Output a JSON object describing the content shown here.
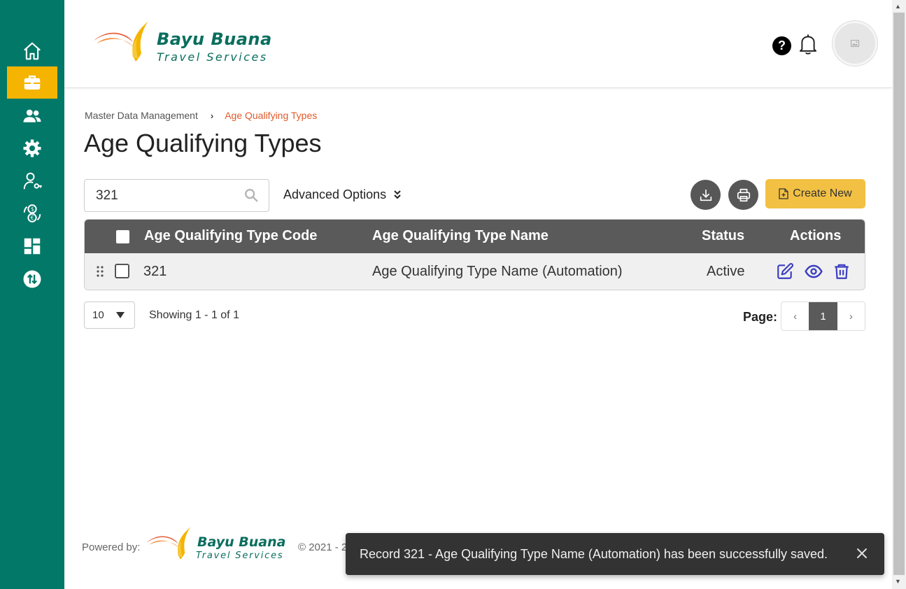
{
  "brand": {
    "name": "Bayu Buana",
    "tagline": "Travel Services",
    "primary_color": "#017868",
    "accent_color": "#f4b400"
  },
  "sidebar": {
    "items": [
      {
        "name": "home",
        "icon": "home-icon",
        "active": false
      },
      {
        "name": "briefcase",
        "icon": "briefcase-icon",
        "active": true
      },
      {
        "name": "users",
        "icon": "users-icon",
        "active": false
      },
      {
        "name": "settings",
        "icon": "gear-icon",
        "active": false
      },
      {
        "name": "user-key",
        "icon": "user-key-icon",
        "active": false
      },
      {
        "name": "currency-exchange",
        "icon": "currency-exchange-icon",
        "active": false
      },
      {
        "name": "dashboard",
        "icon": "dashboard-icon",
        "active": false
      },
      {
        "name": "transfer",
        "icon": "transfer-icon",
        "active": false
      }
    ]
  },
  "header": {
    "help_label": "?"
  },
  "breadcrumb": {
    "parent": "Master Data Management",
    "separator": "›",
    "current": "Age Qualifying Types"
  },
  "page": {
    "title": "Age Qualifying Types"
  },
  "toolbar": {
    "search_value": "321",
    "advanced_options_label": "Advanced Options",
    "advanced_options_chevron": "»",
    "create_label": "Create New"
  },
  "table": {
    "columns": [
      "Age Qualifying Type Code",
      "Age Qualifying Type Name",
      "Status",
      "Actions"
    ],
    "rows": [
      {
        "code": "321",
        "name": "Age Qualifying Type Name (Automation)",
        "status": "Active"
      }
    ]
  },
  "pagination": {
    "page_size": "10",
    "showing": "Showing 1 - 1 of 1",
    "page_label": "Page:",
    "prev": "‹",
    "current_page": "1",
    "next": "›"
  },
  "footer": {
    "powered_by": "Powered by:",
    "copyright": "© 2021 - 2"
  },
  "toast": {
    "message": "Record 321 - Age Qualifying Type Name (Automation) has been successfully saved.",
    "close": "✕"
  }
}
